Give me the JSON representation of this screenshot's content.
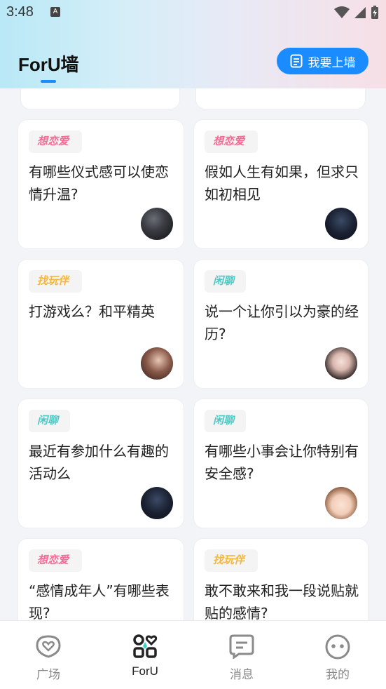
{
  "status": {
    "time": "3:48"
  },
  "header": {
    "title": "ForU墙",
    "post_button": "我要上墙"
  },
  "cards": [
    {
      "tag": "想恋爱",
      "tag_type": "love",
      "text": "有哪些仪式感可以使恋情升温?",
      "avatar": "dark-silhouette"
    },
    {
      "tag": "想恋爱",
      "tag_type": "love",
      "text": "假如人生有如果，但求只如初相见",
      "avatar": "dark-figure"
    },
    {
      "tag": "找玩伴",
      "tag_type": "play",
      "text": "打游戏么？和平精英",
      "avatar": "girl-side-profile"
    },
    {
      "tag": "闲聊",
      "tag_type": "chat",
      "text": "说一个让你引以为豪的经历?",
      "avatar": "girl-long-hair"
    },
    {
      "tag": "闲聊",
      "tag_type": "chat",
      "text": "最近有参加什么有趣的活动么",
      "avatar": "dark-figure"
    },
    {
      "tag": "闲聊",
      "tag_type": "chat",
      "text": "有哪些小事会让你特别有安全感?",
      "avatar": "cartoon-boy"
    },
    {
      "tag": "想恋爱",
      "tag_type": "love",
      "text": "“感情成年人”有哪些表现?",
      "avatar": ""
    },
    {
      "tag": "找玩伴",
      "tag_type": "play",
      "text": "敢不敢来和我一段说贴就贴的感情?",
      "avatar": ""
    }
  ],
  "tabbar": [
    {
      "label": "广场",
      "icon": "heart-bubble-icon"
    },
    {
      "label": "ForU",
      "icon": "grid-heart-icon",
      "active": true
    },
    {
      "label": "消息",
      "icon": "message-icon"
    },
    {
      "label": "我的",
      "icon": "face-icon"
    }
  ],
  "colors": {
    "accent": "#1a8cff",
    "love": "#f26b95",
    "play": "#f6b736",
    "chat": "#4fc9c5"
  }
}
